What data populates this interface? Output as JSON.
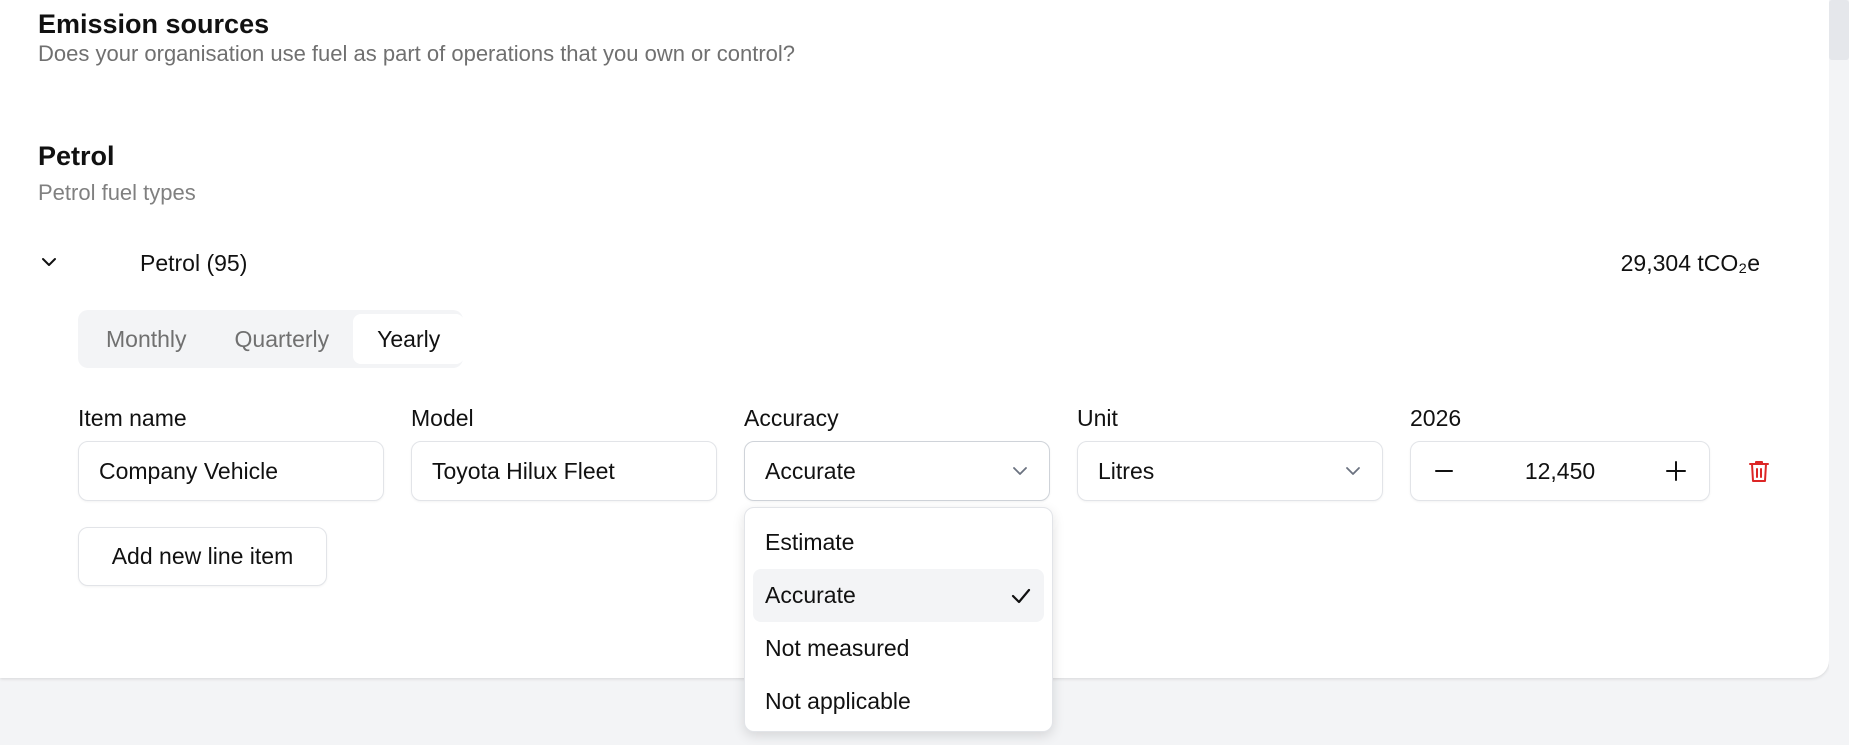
{
  "section": {
    "title": "Emission sources",
    "question": "Does your organisation use fuel as part of operations that you own or control?"
  },
  "group": {
    "title": "Petrol",
    "subtitle": "Petrol fuel types"
  },
  "fuel_item": {
    "name": "Petrol (95)",
    "emissions": "29,304 tCO₂e"
  },
  "period_tabs": [
    {
      "label": "Monthly",
      "active": false
    },
    {
      "label": "Quarterly",
      "active": false
    },
    {
      "label": "Yearly",
      "active": true
    }
  ],
  "fields": {
    "item_name": {
      "label": "Item name",
      "value": "Company Vehicle"
    },
    "model": {
      "label": "Model",
      "value": "Toyota Hilux Fleet"
    },
    "accuracy": {
      "label": "Accuracy",
      "value": "Accurate"
    },
    "unit": {
      "label": "Unit",
      "value": "Litres"
    },
    "year": {
      "label": "2026",
      "value": "12,450"
    }
  },
  "add_button_label": "Add new line item",
  "accuracy_options": [
    {
      "label": "Estimate",
      "selected": false
    },
    {
      "label": "Accurate",
      "selected": true
    },
    {
      "label": "Not measured",
      "selected": false
    },
    {
      "label": "Not applicable",
      "selected": false
    }
  ],
  "colors": {
    "delete_icon": "#dc2626",
    "muted_text": "#707070",
    "page_background": "#f3f4f6"
  },
  "icons": {
    "toggle": "chevron-down-icon",
    "select": "chevron-down-icon",
    "decrement": "minus-icon",
    "increment": "plus-icon",
    "delete": "trash-icon",
    "selected_option": "check-icon"
  }
}
